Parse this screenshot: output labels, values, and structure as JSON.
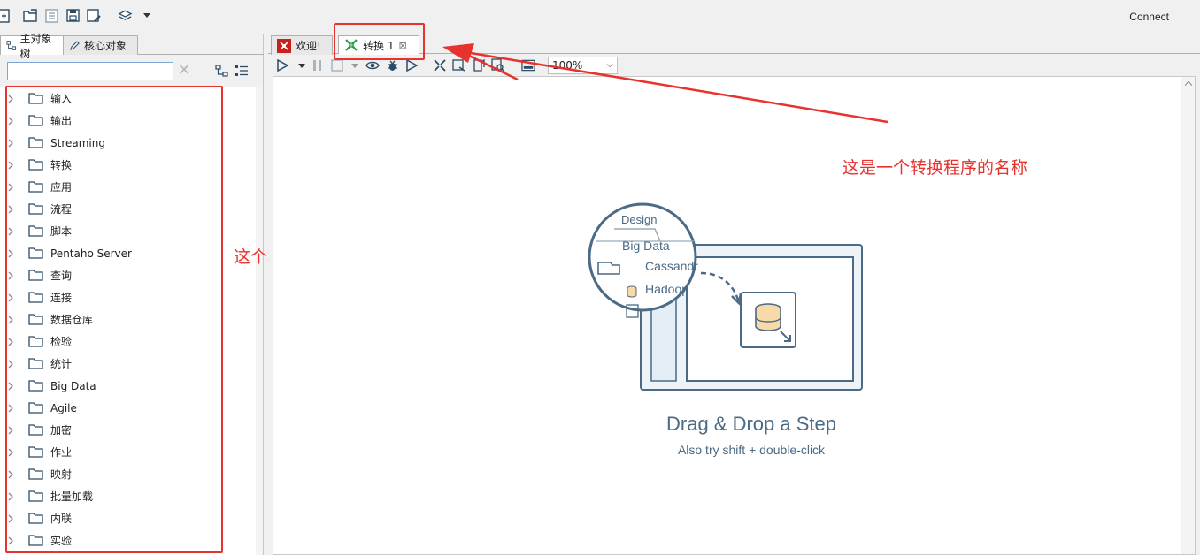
{
  "toolbar": {
    "connect_label": "Connect"
  },
  "left": {
    "tabs": [
      {
        "label": "主对象树"
      },
      {
        "label": "核心对象"
      }
    ],
    "search": {
      "value": "",
      "placeholder": ""
    },
    "tree_items": [
      "输入",
      "输出",
      "Streaming",
      "转换",
      "应用",
      "流程",
      "脚本",
      "Pentaho Server",
      "查询",
      "连接",
      "数据仓库",
      "检验",
      "统计",
      "Big Data",
      "Agile",
      "加密",
      "作业",
      "映射",
      "批量加载",
      "内联",
      "实验"
    ]
  },
  "doc_tabs": [
    {
      "label": "欢迎!"
    },
    {
      "label": "转换 1"
    }
  ],
  "canvas_toolbar": {
    "zoom": "100%"
  },
  "canvas": {
    "design_tab": "Design",
    "design_folder": "Big Data",
    "design_item1": "Cassandra",
    "design_item2": "Hadoop",
    "drag_title": "Drag & Drop a Step",
    "drag_subtitle": "Also try shift + double-click"
  },
  "annotations": {
    "tab_note": "这是一个转换程序的名称",
    "tree_note": "这个程序中可以执行的操作"
  },
  "colors": {
    "annotation": "#e8322e",
    "accent": "#4a6a85"
  }
}
